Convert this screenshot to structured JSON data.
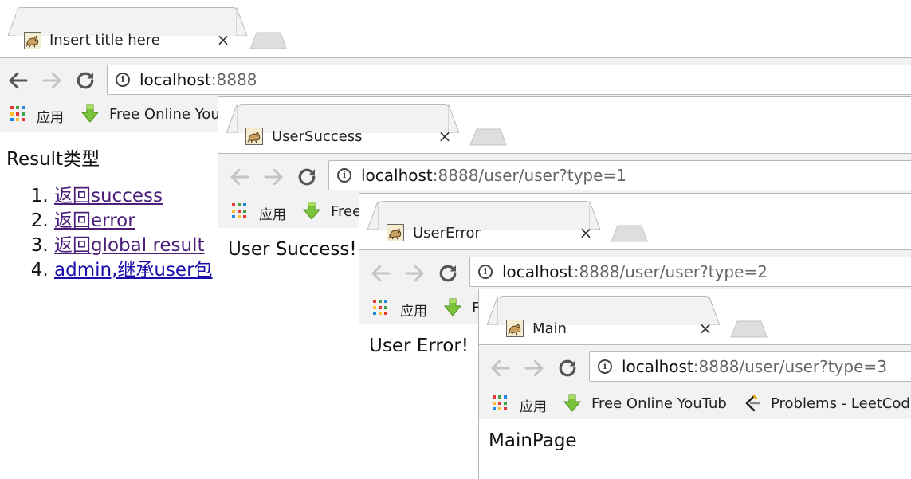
{
  "windows": [
    {
      "id": "w1",
      "tab_title": "Insert title here",
      "url_host": "localhost",
      "url_path": ":8888",
      "bookmarks": {
        "apps": "应用",
        "item1": "Free Online You"
      },
      "content": {
        "heading": "Result类型",
        "links": [
          "返回success",
          "返回error",
          "返回global result",
          "admin,继承user包"
        ]
      }
    },
    {
      "id": "w2",
      "tab_title": "UserSuccess",
      "url_host": "localhost",
      "url_path": ":8888/user/user?type=1",
      "bookmarks": {
        "apps": "应用",
        "item1": "Free"
      },
      "content_text": "User Success!"
    },
    {
      "id": "w3",
      "tab_title": "UserError",
      "url_host": "localhost",
      "url_path": ":8888/user/user?type=2",
      "bookmarks": {
        "apps": "应用",
        "item1": "F"
      },
      "content_text": "User Error!"
    },
    {
      "id": "w4",
      "tab_title": "Main",
      "url_host": "localhost",
      "url_path": ":8888/user/user?type=3",
      "bookmarks": {
        "apps": "应用",
        "item1": "Free Online YouTub",
        "item2": "Problems - LeetCod"
      },
      "content_text": "MainPage"
    }
  ],
  "icons": {
    "tab_favicon": "tomcat-icon",
    "close": "close-icon",
    "back": "back-arrow-icon",
    "forward": "forward-arrow-icon",
    "reload": "reload-icon",
    "site_info": "info-icon",
    "apps": "apps-grid-icon",
    "download": "download-arrow-icon",
    "leetcode": "leetcode-icon"
  },
  "colors": {
    "link_visited": "#4b1f7a",
    "link_unvisited": "#1a0dab",
    "toolbar_bg": "#f2f2f2",
    "url_path": "#666666"
  }
}
